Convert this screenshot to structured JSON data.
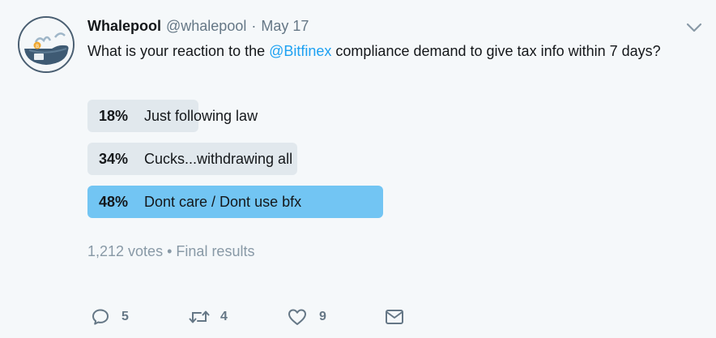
{
  "tweet": {
    "name": "Whalepool",
    "handle": "@whalepool",
    "separator": "·",
    "date": "May 17",
    "text_before": "What is your reaction to the ",
    "mention": "@Bitfinex",
    "text_after": " compliance demand to give tax info within 7 days?"
  },
  "poll": {
    "options": [
      {
        "percent": "18%",
        "label": "Just following law",
        "share": 0.18,
        "winner": false
      },
      {
        "percent": "34%",
        "label": "Cucks...withdrawing all",
        "share": 0.34,
        "winner": false
      },
      {
        "percent": "48%",
        "label": "Dont care / Dont use bfx",
        "share": 0.48,
        "winner": true
      }
    ],
    "votes": "1,212 votes",
    "bullet": "•",
    "status": "Final results"
  },
  "actions": {
    "reply_count": "5",
    "retweet_count": "4",
    "like_count": "9"
  },
  "icons": {
    "reply": "reply-icon",
    "retweet": "retweet-icon",
    "like": "heart-icon",
    "message": "envelope-icon",
    "caret": "chevron-down-icon"
  },
  "colors": {
    "accent": "#1da1f2",
    "winner_bar": "#72c5f3",
    "bar": "#e1e8ed",
    "muted": "#657786"
  }
}
